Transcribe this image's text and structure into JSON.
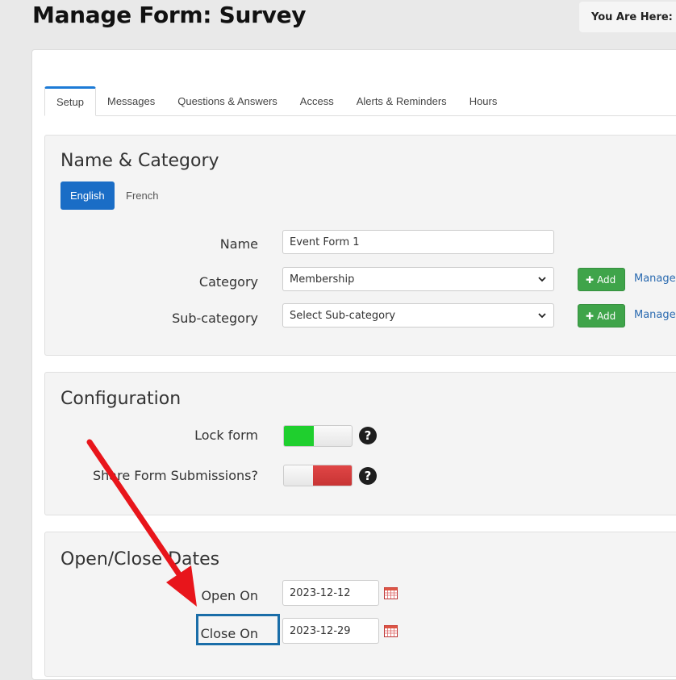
{
  "page_title": "Manage Form: Survey",
  "breadcrumb": {
    "label": "You Are Here:",
    "separator": "/"
  },
  "tabs": [
    {
      "label": "Setup",
      "active": true
    },
    {
      "label": "Messages"
    },
    {
      "label": "Questions & Answers"
    },
    {
      "label": "Access"
    },
    {
      "label": "Alerts & Reminders"
    },
    {
      "label": "Hours"
    }
  ],
  "name_category": {
    "title": "Name & Category",
    "languages": [
      {
        "label": "English",
        "active": true
      },
      {
        "label": "French"
      }
    ],
    "name_label": "Name",
    "name_value": "Event Form 1",
    "category_label": "Category",
    "category_value": "Membership",
    "subcategory_label": "Sub-category",
    "subcategory_value": "Select Sub-category",
    "add_label": "Add",
    "manage_label": "Manage"
  },
  "configuration": {
    "title": "Configuration",
    "lock_form_label": "Lock form",
    "lock_form_on": true,
    "share_label": "Share Form Submissions?",
    "share_on": false
  },
  "dates": {
    "title": "Open/Close Dates",
    "open_label": "Open On",
    "open_value": "2023-12-12",
    "close_label": "Close On",
    "close_value": "2023-12-29"
  },
  "colors": {
    "primary": "#1a6dc6",
    "success": "#3fa44a",
    "toggle_on": "#1fcf2e",
    "toggle_off": "#d63c3c",
    "annotation_arrow": "#e8151b",
    "annotation_box": "#1a6da8"
  }
}
